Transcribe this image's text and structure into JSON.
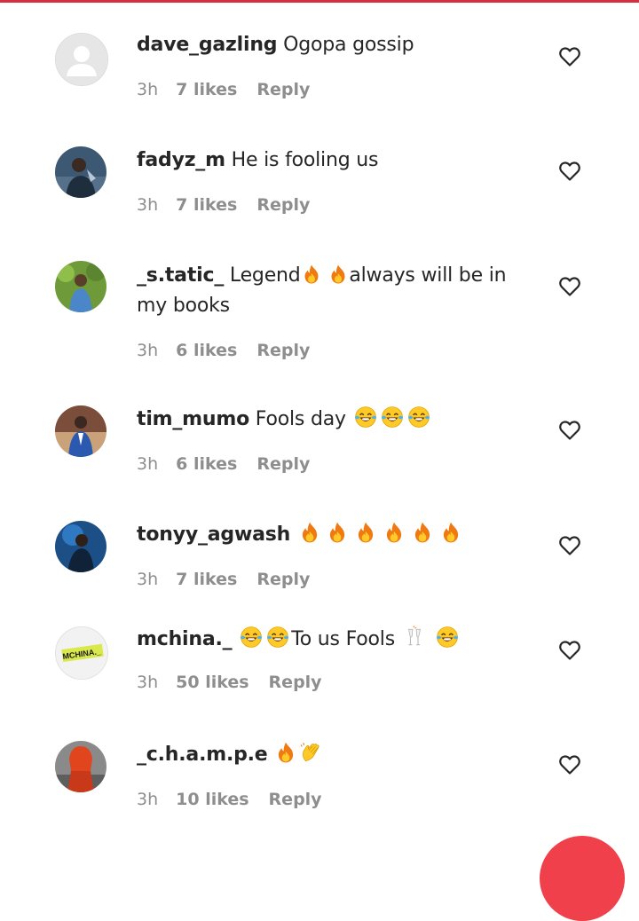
{
  "accent_color": "#d62e3e",
  "comments": [
    {
      "username": "dave_gazling",
      "text": " Ogopa gossip",
      "time": "3h",
      "likes": "7 likes",
      "reply": "Reply",
      "avatar": "default-avatar"
    },
    {
      "username": "fadyz_m",
      "text": " He is fooling us",
      "time": "3h",
      "likes": "7 likes",
      "reply": "Reply",
      "avatar": "photo-avatar"
    },
    {
      "username": "_s.tatic_",
      "text_part1": " Legend",
      "text_part2": "always will be in my books",
      "time": "3h",
      "likes": "6 likes",
      "reply": "Reply",
      "avatar": "photo-avatar"
    },
    {
      "username": "tim_mumo",
      "text": " Fools day ",
      "time": "3h",
      "likes": "6 likes",
      "reply": "Reply",
      "avatar": "photo-avatar"
    },
    {
      "username": "tonyy_agwash",
      "time": "3h",
      "likes": "7 likes",
      "reply": "Reply",
      "avatar": "photo-avatar"
    },
    {
      "username": "mchina._",
      "text": "To us Fools ",
      "time": "3h",
      "likes": "50 likes",
      "reply": "Reply",
      "avatar": "logo-avatar",
      "avatar_logo_text": "MCHINA._"
    },
    {
      "username": "_c.h.a.m.p.e",
      "time": "3h",
      "likes": "10 likes",
      "reply": "Reply",
      "avatar": "photo-avatar"
    }
  ],
  "icons": {
    "like": "heart-outline-icon",
    "fire": "fire-emoji",
    "laugh": "tears-of-joy-emoji",
    "cheers": "clinking-glasses-emoji",
    "clap": "clapping-hands-emoji"
  }
}
